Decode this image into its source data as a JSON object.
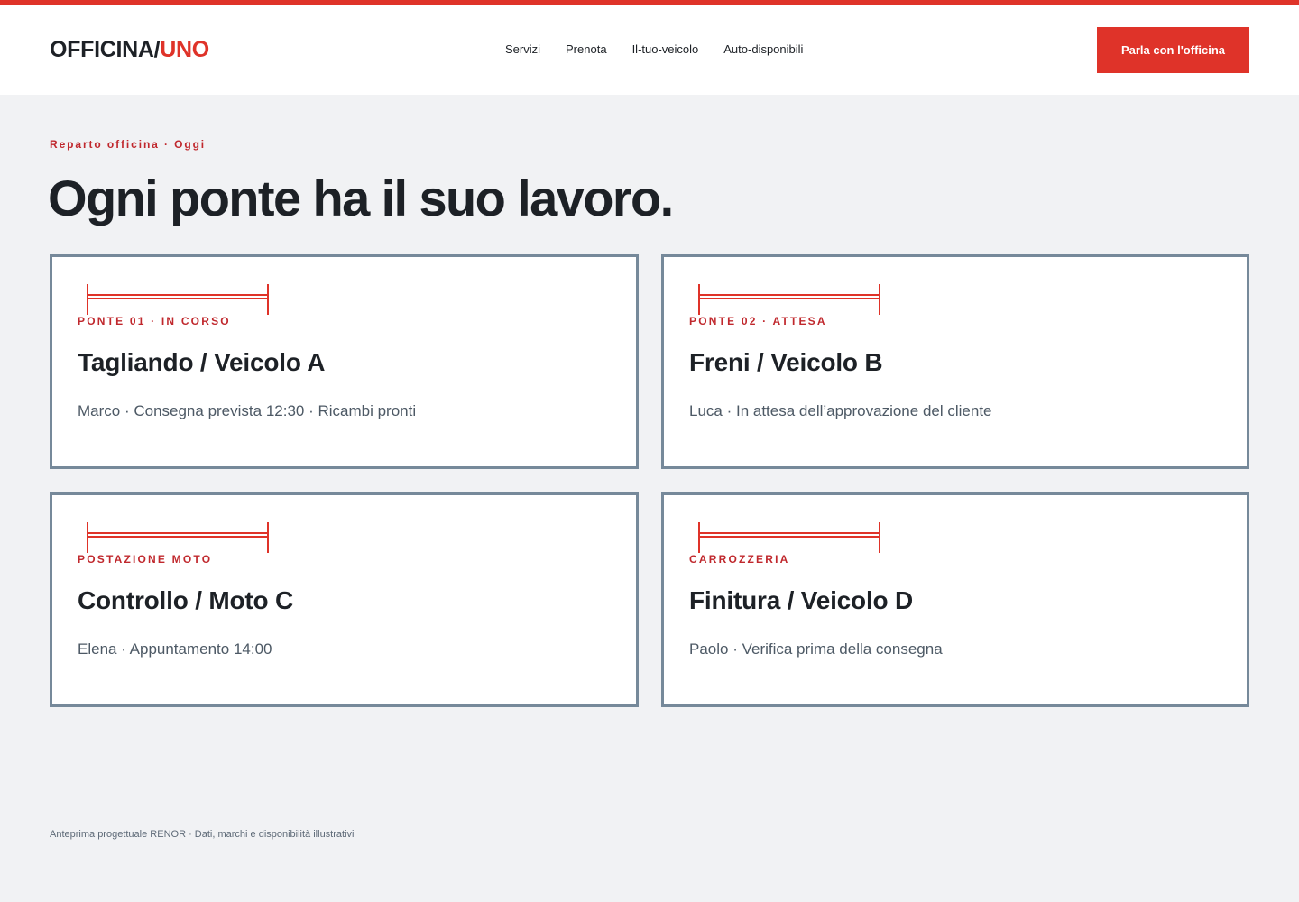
{
  "brand": {
    "name_part1": "OFFICINA/",
    "name_part2": "UNO",
    "accent_color": "#df3329"
  },
  "nav": {
    "items": [
      {
        "label": "Servizi"
      },
      {
        "label": "Prenota"
      },
      {
        "label": "Il-tuo-veicolo"
      },
      {
        "label": "Auto-disponibili"
      }
    ],
    "cta_label": "Parla con l'officina"
  },
  "hero": {
    "eyebrow": "Reparto officina · Oggi",
    "title": "Ogni ponte ha il suo lavoro."
  },
  "cards": [
    {
      "icon": "car-lift-icon",
      "label": "PONTE 01 · IN CORSO",
      "title": "Tagliando / Veicolo A",
      "meta": "Marco · Consegna prevista 12:30 · Ricambi pronti"
    },
    {
      "icon": "car-lift-icon",
      "label": "PONTE 02 · ATTESA",
      "title": "Freni / Veicolo B",
      "meta": "Luca · In attesa dell’approvazione del cliente"
    },
    {
      "icon": "car-lift-icon",
      "label": "POSTAZIONE MOTO",
      "title": "Controllo / Moto C",
      "meta": "Elena · Appuntamento 14:00"
    },
    {
      "icon": "car-lift-icon",
      "label": "CARROZZERIA",
      "title": "Finitura / Veicolo D",
      "meta": "Paolo · Verifica prima della consegna"
    }
  ],
  "footer": {
    "text": "Anteprima progettuale RENOR · Dati, marchi e disponibilità illustrativi"
  }
}
